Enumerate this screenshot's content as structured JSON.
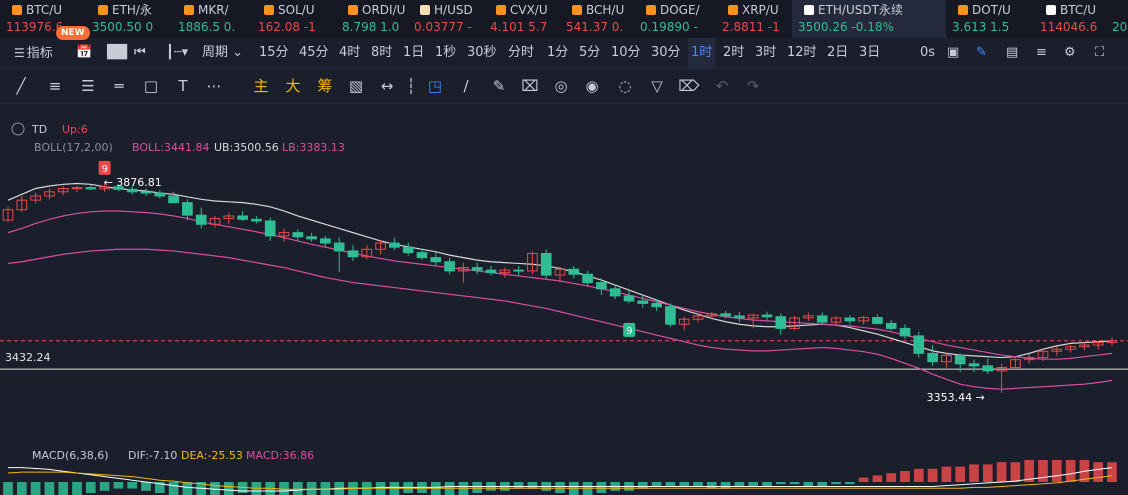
{
  "tickers": [
    {
      "name": "BTC/U",
      "price": "113976.6",
      "color": "up",
      "coin": "#f7931a"
    },
    {
      "name": "ETH/永",
      "price": "3500.50 0",
      "color": "dn",
      "coin": "#f7931a"
    },
    {
      "name": "MKR/",
      "price": "1886.5 0.",
      "color": "dn",
      "coin": "#f7931a"
    },
    {
      "name": "SOL/U",
      "price": "162.08 -1",
      "color": "up",
      "coin": "#f7931a"
    },
    {
      "name": "ORDI/U",
      "price": "8.798 1.0",
      "color": "dn",
      "coin": "#f7931a"
    },
    {
      "name": "H/USD",
      "price": "0.03777 -",
      "color": "up",
      "coin": "#f5deb3"
    },
    {
      "name": "CVX/U",
      "price": "4.101 5.7",
      "color": "up",
      "coin": "#f7931a"
    },
    {
      "name": "BCH/U",
      "price": "541.37 0.",
      "color": "up",
      "coin": "#f7931a"
    },
    {
      "name": "DOGE/",
      "price": "0.19890 -",
      "color": "dn",
      "coin": "#f7931a"
    },
    {
      "name": "XRP/U",
      "price": "2.8811 -1",
      "color": "up",
      "coin": "#f7931a"
    },
    {
      "name": "ETH/USDT永续",
      "price": "3500.26 -0.18%",
      "color": "dn",
      "coin": "#ffffff"
    },
    {
      "name": "DOT/U",
      "price": "3.613 1.5",
      "color": "dn",
      "coin": "#f7931a"
    },
    {
      "name": "BTC/U",
      "price": "114046.6",
      "color": "up",
      "coin": "#ffffff"
    },
    {
      "name": "",
      "price": "20.",
      "color": "dn",
      "coin": ""
    }
  ],
  "toolbar": {
    "indicator_label": "指标",
    "new_badge": "NEW",
    "period_label": "周期",
    "intervals": [
      "15分",
      "45分",
      "4时",
      "8时",
      "1日",
      "1秒",
      "30秒",
      "分时",
      "1分",
      "5分",
      "10分",
      "30分",
      "1时",
      "2时",
      "3时",
      "12时",
      "2日",
      "3日"
    ],
    "selected_interval": "1时",
    "seconds_label": "0s"
  },
  "drawtools": {
    "main_label": "主",
    "big_label": "大",
    "chip_label": "筹"
  },
  "chart_data": {
    "type": "candlestick",
    "symbol": "ETH/USDT永续",
    "interval": "1时",
    "indicators": {
      "td": {
        "label": "TD",
        "value_label": "Up:6"
      },
      "boll": {
        "label": "BOLL(17,2,00)",
        "mid": "BOLL:3441.84",
        "ub": "UB:3500.56",
        "lb": "LB:3383.13"
      },
      "macd": {
        "label": "MACD(6,38,6)",
        "dif": "DIF:-7.10",
        "dea": "DEA:-25.53",
        "macd": "MACD:36.86"
      }
    },
    "annotations": {
      "high_label": "3876.81",
      "low_label": "3353.44",
      "horizontal_line_label": "3432.24",
      "td_top": "9",
      "td_bottom": "9"
    },
    "ylim": [
      3310,
      3920
    ],
    "h_line_value": 3432.24,
    "last_price": 3500.26,
    "candles": [
      [
        3790,
        3822,
        3785,
        3815
      ],
      [
        3815,
        3848,
        3810,
        3838
      ],
      [
        3838,
        3856,
        3830,
        3848
      ],
      [
        3848,
        3866,
        3840,
        3858
      ],
      [
        3858,
        3872,
        3850,
        3866
      ],
      [
        3866,
        3872,
        3858,
        3868
      ],
      [
        3868,
        3874,
        3862,
        3865
      ],
      [
        3865,
        3877,
        3858,
        3870
      ],
      [
        3870,
        3876,
        3860,
        3864
      ],
      [
        3864,
        3872,
        3852,
        3858
      ],
      [
        3858,
        3866,
        3848,
        3855
      ],
      [
        3855,
        3862,
        3842,
        3848
      ],
      [
        3848,
        3858,
        3830,
        3832
      ],
      [
        3832,
        3840,
        3790,
        3802
      ],
      [
        3802,
        3820,
        3770,
        3780
      ],
      [
        3780,
        3800,
        3772,
        3794
      ],
      [
        3794,
        3808,
        3780,
        3800
      ],
      [
        3800,
        3812,
        3788,
        3792
      ],
      [
        3792,
        3800,
        3782,
        3788
      ],
      [
        3788,
        3796,
        3740,
        3752
      ],
      [
        3752,
        3770,
        3738,
        3760
      ],
      [
        3760,
        3768,
        3740,
        3750
      ],
      [
        3750,
        3760,
        3738,
        3745
      ],
      [
        3745,
        3752,
        3725,
        3735
      ],
      [
        3735,
        3748,
        3665,
        3716
      ],
      [
        3716,
        3730,
        3692,
        3702
      ],
      [
        3702,
        3730,
        3696,
        3720
      ],
      [
        3720,
        3742,
        3708,
        3735
      ],
      [
        3735,
        3748,
        3718,
        3725
      ],
      [
        3725,
        3736,
        3705,
        3712
      ],
      [
        3712,
        3722,
        3695,
        3700
      ],
      [
        3700,
        3712,
        3682,
        3690
      ],
      [
        3690,
        3700,
        3660,
        3668
      ],
      [
        3668,
        3688,
        3640,
        3676
      ],
      [
        3676,
        3688,
        3660,
        3670
      ],
      [
        3670,
        3680,
        3658,
        3664
      ],
      [
        3664,
        3676,
        3652,
        3670
      ],
      [
        3670,
        3680,
        3658,
        3668
      ],
      [
        3668,
        3715,
        3660,
        3710
      ],
      [
        3710,
        3720,
        3650,
        3658
      ],
      [
        3658,
        3678,
        3640,
        3672
      ],
      [
        3672,
        3680,
        3650,
        3660
      ],
      [
        3660,
        3668,
        3630,
        3640
      ],
      [
        3640,
        3650,
        3610,
        3625
      ],
      [
        3625,
        3636,
        3600,
        3608
      ],
      [
        3608,
        3622,
        3590,
        3596
      ],
      [
        3596,
        3610,
        3580,
        3590
      ],
      [
        3590,
        3600,
        3572,
        3582
      ],
      [
        3582,
        3590,
        3534,
        3540
      ],
      [
        3540,
        3558,
        3525,
        3552
      ],
      [
        3552,
        3565,
        3545,
        3560
      ],
      [
        3560,
        3570,
        3552,
        3565
      ],
      [
        3565,
        3572,
        3555,
        3560
      ],
      [
        3560,
        3570,
        3545,
        3555
      ],
      [
        3555,
        3565,
        3530,
        3562
      ],
      [
        3562,
        3570,
        3550,
        3558
      ],
      [
        3558,
        3566,
        3515,
        3530
      ],
      [
        3530,
        3560,
        3525,
        3555
      ],
      [
        3555,
        3568,
        3548,
        3560
      ],
      [
        3560,
        3568,
        3540,
        3545
      ],
      [
        3545,
        3560,
        3535,
        3555
      ],
      [
        3555,
        3562,
        3540,
        3548
      ],
      [
        3548,
        3560,
        3540,
        3556
      ],
      [
        3556,
        3564,
        3540,
        3542
      ],
      [
        3542,
        3550,
        3525,
        3530
      ],
      [
        3530,
        3540,
        3505,
        3512
      ],
      [
        3512,
        3522,
        3460,
        3470
      ],
      [
        3470,
        3490,
        3440,
        3450
      ],
      [
        3450,
        3470,
        3435,
        3465
      ],
      [
        3465,
        3470,
        3425,
        3445
      ],
      [
        3445,
        3455,
        3425,
        3440
      ],
      [
        3440,
        3458,
        3420,
        3428
      ],
      [
        3428,
        3445,
        3375,
        3436
      ],
      [
        3436,
        3460,
        3430,
        3455
      ],
      [
        3455,
        3468,
        3445,
        3460
      ],
      [
        3460,
        3480,
        3452,
        3475
      ],
      [
        3475,
        3486,
        3465,
        3480
      ],
      [
        3480,
        3490,
        3472,
        3486
      ],
      [
        3486,
        3496,
        3478,
        3490
      ],
      [
        3490,
        3500,
        3480,
        3496
      ],
      [
        3496,
        3508,
        3488,
        3500
      ]
    ],
    "bb_upper": [
      3838,
      3852,
      3866,
      3872,
      3876,
      3878,
      3876,
      3870,
      3866,
      3862,
      3860,
      3855,
      3852,
      3846,
      3840,
      3836,
      3834,
      3832,
      3828,
      3822,
      3812,
      3800,
      3790,
      3780,
      3770,
      3760,
      3750,
      3740,
      3732,
      3726,
      3720,
      3714,
      3706,
      3700,
      3694,
      3690,
      3688,
      3686,
      3684,
      3680,
      3674,
      3666,
      3656,
      3646,
      3634,
      3622,
      3610,
      3598,
      3586,
      3574,
      3564,
      3554,
      3546,
      3540,
      3536,
      3534,
      3534,
      3536,
      3538,
      3540,
      3538,
      3532,
      3524,
      3516,
      3506,
      3496,
      3486,
      3476,
      3470,
      3466,
      3464,
      3462,
      3460,
      3462,
      3470,
      3480,
      3488,
      3494,
      3496,
      3498,
      3500
    ],
    "bb_mid": [
      3760,
      3770,
      3782,
      3792,
      3800,
      3806,
      3810,
      3812,
      3812,
      3810,
      3808,
      3805,
      3800,
      3794,
      3786,
      3780,
      3774,
      3768,
      3762,
      3755,
      3748,
      3740,
      3732,
      3725,
      3718,
      3710,
      3704,
      3698,
      3692,
      3688,
      3684,
      3680,
      3676,
      3672,
      3668,
      3664,
      3660,
      3656,
      3652,
      3648,
      3644,
      3638,
      3632,
      3625,
      3618,
      3610,
      3602,
      3594,
      3586,
      3578,
      3570,
      3564,
      3558,
      3554,
      3550,
      3548,
      3546,
      3544,
      3542,
      3540,
      3538,
      3536,
      3532,
      3528,
      3522,
      3514,
      3506,
      3498,
      3490,
      3484,
      3478,
      3472,
      3466,
      3462,
      3458,
      3456,
      3456,
      3458,
      3462,
      3466,
      3470
    ],
    "bb_lower": [
      3686,
      3690,
      3696,
      3702,
      3708,
      3712,
      3716,
      3718,
      3720,
      3720,
      3720,
      3718,
      3716,
      3712,
      3708,
      3704,
      3700,
      3694,
      3688,
      3682,
      3676,
      3668,
      3660,
      3652,
      3646,
      3640,
      3636,
      3632,
      3628,
      3624,
      3620,
      3616,
      3612,
      3608,
      3604,
      3600,
      3596,
      3590,
      3584,
      3578,
      3570,
      3562,
      3554,
      3546,
      3538,
      3530,
      3522,
      3514,
      3506,
      3498,
      3490,
      3484,
      3480,
      3478,
      3476,
      3476,
      3478,
      3480,
      3482,
      3484,
      3482,
      3478,
      3474,
      3468,
      3458,
      3446,
      3434,
      3420,
      3408,
      3396,
      3390,
      3386,
      3384,
      3386,
      3388,
      3390,
      3392,
      3394,
      3396,
      3400,
      3405
    ],
    "macd_hist": [
      -6,
      -7,
      -8,
      -8,
      -7,
      -6,
      -5,
      -4,
      -3,
      -3,
      -4,
      -5,
      -6,
      -7,
      -8,
      -7,
      -6,
      -5,
      -6,
      -7,
      -8,
      -8,
      -7,
      -6,
      -6,
      -7,
      -8,
      -7,
      -6,
      -5,
      -5,
      -6,
      -7,
      -6,
      -5,
      -4,
      -4,
      -3,
      -3,
      -4,
      -5,
      -6,
      -6,
      -5,
      -4,
      -4,
      -3,
      -2,
      -2,
      -2,
      -2,
      -3,
      -3,
      -2,
      -2,
      -2,
      -1,
      -1,
      -2,
      -2,
      -1,
      -1,
      2,
      3,
      4,
      5,
      6,
      6,
      7,
      7,
      8,
      8,
      9,
      9,
      10,
      10,
      10,
      10,
      10,
      9,
      9
    ],
    "macd_dif": [
      16,
      16,
      15,
      14,
      12,
      10,
      8,
      6,
      4,
      2,
      0,
      -2,
      -4,
      -6,
      -7,
      -8,
      -9,
      -10,
      -10,
      -10,
      -10,
      -9,
      -8,
      -8,
      -7,
      -7,
      -7,
      -6,
      -6,
      -6,
      -6,
      -6,
      -5,
      -5,
      -5,
      -5,
      -5,
      -5,
      -5,
      -5,
      -5,
      -5,
      -5,
      -5,
      -5,
      -5,
      -5,
      -5,
      -5,
      -5,
      -5,
      -5,
      -5,
      -5,
      -5,
      -5,
      -5,
      -5,
      -5,
      -5,
      -5,
      -5,
      -5,
      -5,
      -5,
      -5,
      -5,
      -5,
      -4,
      -3,
      -2,
      -1,
      0,
      1,
      3,
      5,
      7,
      9,
      12,
      14,
      16
    ],
    "macd_dea": [
      10,
      11,
      11,
      11,
      11,
      10,
      9,
      8,
      7,
      6,
      4,
      2,
      1,
      -1,
      -2,
      -4,
      -5,
      -6,
      -7,
      -7,
      -8,
      -8,
      -8,
      -8,
      -8,
      -7,
      -7,
      -7,
      -7,
      -7,
      -7,
      -7,
      -7,
      -7,
      -7,
      -7,
      -7,
      -7,
      -7,
      -7,
      -7,
      -7,
      -7,
      -7,
      -7,
      -7,
      -7,
      -7,
      -7,
      -7,
      -7,
      -7,
      -7,
      -7,
      -7,
      -7,
      -7,
      -7,
      -7,
      -7,
      -7,
      -7,
      -7,
      -7,
      -7,
      -7,
      -7,
      -7,
      -7,
      -7,
      -6,
      -6,
      -5,
      -4,
      -3,
      -2,
      -1,
      1,
      3,
      5,
      7
    ]
  },
  "colors": {
    "up": "#e84a4a",
    "down": "#2fbd94",
    "boll_upper": "#d8d8d8",
    "boll_lower": "#d94fa0",
    "boll_mid": "#d94fa0",
    "dea": "#f0b90b",
    "dif": "#ffffff",
    "accent": "#3f8cff"
  }
}
